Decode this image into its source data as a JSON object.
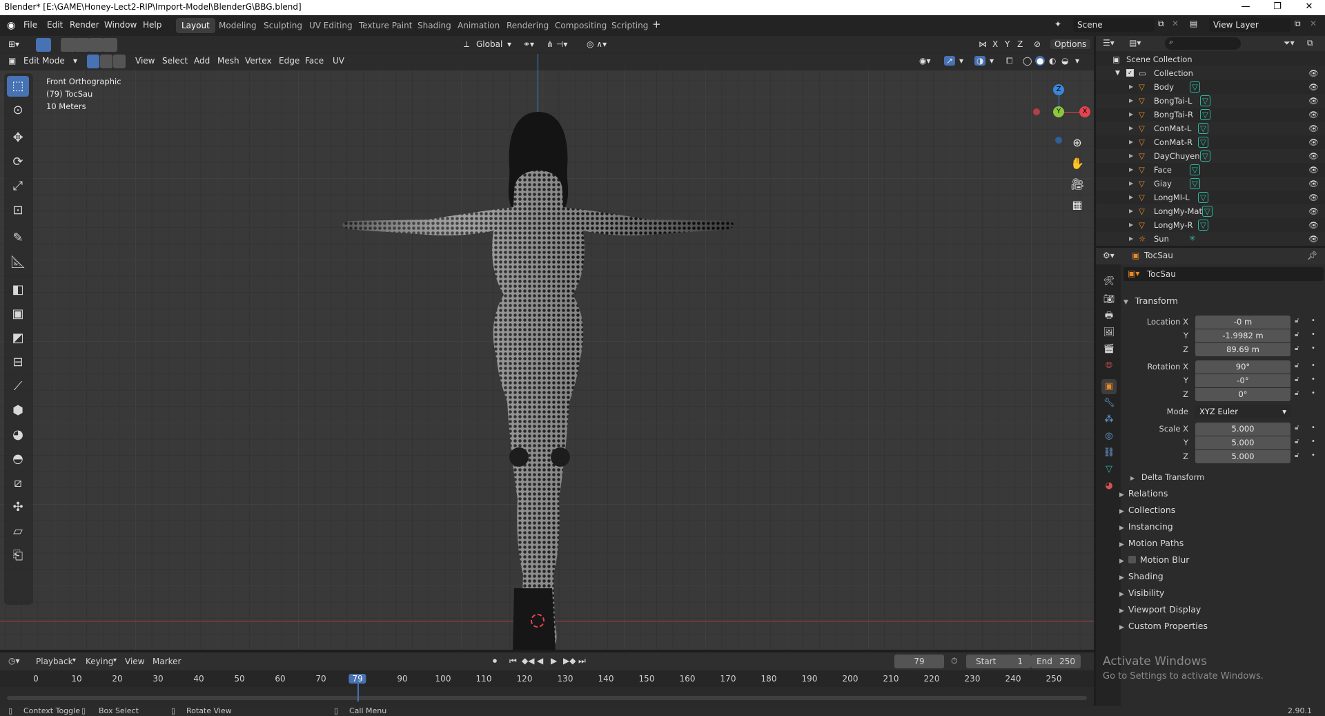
{
  "os_titlebar": {
    "title": "Blender* [E:\\GAME\\Honey-Lect2-RIP\\Import-Model\\BlenderG\\BBG.blend]"
  },
  "menu": [
    "File",
    "Edit",
    "Render",
    "Window",
    "Help"
  ],
  "workspaces": [
    "Layout",
    "Modeling",
    "Sculpting",
    "UV Editing",
    "Texture Paint",
    "Shading",
    "Animation",
    "Rendering",
    "Compositing",
    "Scripting"
  ],
  "scene": {
    "scene_name": "Scene",
    "view_layer": "View Layer"
  },
  "viewport_header": {
    "orientation": "Global",
    "options": "Options",
    "axes": [
      "X",
      "Y",
      "Z"
    ],
    "mode": "Edit Mode",
    "menus": [
      "View",
      "Select",
      "Add",
      "Mesh",
      "Vertex",
      "Edge",
      "Face",
      "UV"
    ]
  },
  "viewport_info": {
    "view": "Front Orthographic",
    "object": "(79) TocSau",
    "scale": "10 Meters"
  },
  "gizmo": {
    "z": "Z",
    "y": "Y",
    "x": "X"
  },
  "outliner": {
    "root": "Scene Collection",
    "collection": "Collection",
    "items": [
      "Body",
      "BongTai-L",
      "BongTai-R",
      "ConMat-L",
      "ConMat-R",
      "DayChuyen",
      "Face",
      "Giay",
      "LongMI-L",
      "LongMy-Mat",
      "LongMy-R",
      "Sun"
    ]
  },
  "properties": {
    "object_name": "TocSau",
    "datablock_name": "TocSau",
    "transform_label": "Transform",
    "location_label": "Location X",
    "rotation_label": "Rotation X",
    "scale_label": "Scale X",
    "axis_y": "Y",
    "axis_z": "Z",
    "location": [
      "-0 m",
      "-1.9982 m",
      "89.69 m"
    ],
    "rotation": [
      "90°",
      "-0°",
      "0°"
    ],
    "mode_label": "Mode",
    "mode_value": "XYZ Euler",
    "scale": [
      "5.000",
      "5.000",
      "5.000"
    ],
    "delta_transform": "Delta Transform",
    "panels": [
      "Relations",
      "Collections",
      "Instancing",
      "Motion Paths",
      "Motion Blur",
      "Shading",
      "Visibility",
      "Viewport Display",
      "Custom Properties"
    ]
  },
  "timeline": {
    "menus": [
      "Playback",
      "Keying",
      "View",
      "Marker"
    ],
    "current_frame": "79",
    "start_label": "Start",
    "start": "1",
    "end_label": "End",
    "end": "250",
    "ticks": [
      "0",
      "10",
      "20",
      "30",
      "40",
      "50",
      "60",
      "70",
      "79",
      "90",
      "100",
      "110",
      "120",
      "130",
      "140",
      "150",
      "160",
      "170",
      "180",
      "190",
      "200",
      "210",
      "220",
      "230",
      "240",
      "250"
    ]
  },
  "status_bar": {
    "context_toggle": "Context Toggle",
    "box_select": "Box Select",
    "rotate_view": "Rotate View",
    "call_menu": "Call Menu",
    "version": "2.90.1"
  },
  "watermark": {
    "title": "Activate Windows",
    "subtitle": "Go to Settings to activate Windows."
  },
  "colors": {
    "accent": "#4772b3",
    "x_axis": "#e5434f",
    "y_axis": "#8bc83e",
    "z_axis": "#3a86d9",
    "mesh_icon": "#e8892b",
    "data_icon": "#2fb7a1"
  }
}
